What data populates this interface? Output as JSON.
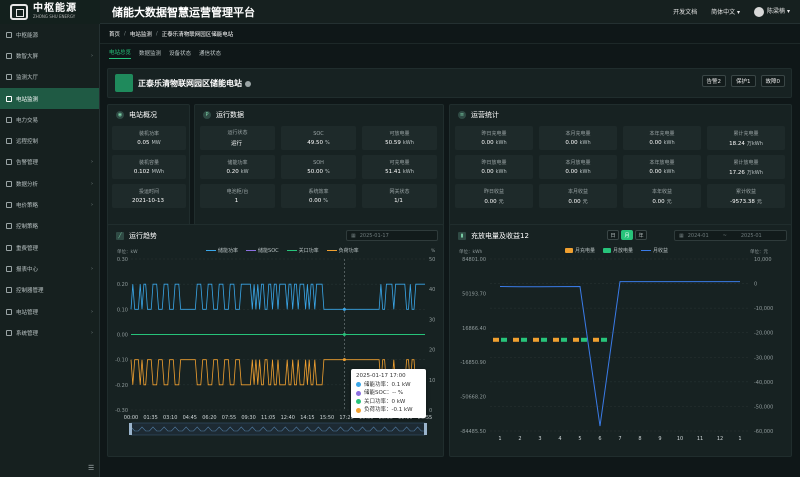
{
  "app": {
    "logo_cn": "中枢能源",
    "logo_en": "ZHONG SHU ENERGY",
    "title": "储能大数据智慧运营管理平台",
    "dev_docs": "开发文档",
    "language": "简体中文",
    "username": "陈梁楠"
  },
  "sidebar": {
    "items": [
      {
        "label": "中枢能源",
        "arrow": false
      },
      {
        "label": "数智大屏",
        "arrow": true
      },
      {
        "label": "监测大厅",
        "arrow": false
      },
      {
        "label": "电站监测",
        "arrow": false,
        "active": true
      },
      {
        "label": "电力交易",
        "arrow": false
      },
      {
        "label": "远程控制",
        "arrow": false
      },
      {
        "label": "告警管理",
        "arrow": true
      },
      {
        "label": "数据分析",
        "arrow": true
      },
      {
        "label": "电价策略",
        "arrow": true
      },
      {
        "label": "控制策略",
        "arrow": false
      },
      {
        "label": "重费管理",
        "arrow": false
      },
      {
        "label": "报表中心",
        "arrow": true
      },
      {
        "label": "控制器管理",
        "arrow": false
      },
      {
        "label": "电站管理",
        "arrow": true
      },
      {
        "label": "系统管理",
        "arrow": true
      }
    ]
  },
  "breadcrumb": [
    "首页",
    "电站监测",
    "正泰乐清物联网园区储能电站"
  ],
  "tabs": [
    "电站总览",
    "数据监测",
    "设备状态",
    "通信状态"
  ],
  "station": {
    "name": "正泰乐清物联网园区储能电站",
    "alarm_buttons": [
      "告警2",
      "保护1",
      "故障0"
    ]
  },
  "overview": {
    "title": "电站概况",
    "cells": [
      {
        "label": "装机功率",
        "value": "0.05",
        "unit": "MW"
      },
      {
        "label": "装机容量",
        "value": "0.102",
        "unit": "MWh"
      },
      {
        "label": "投运时间",
        "value": "2021-10-13",
        "unit": ""
      }
    ]
  },
  "running": {
    "title": "运行数据",
    "cells": [
      {
        "label": "运行状态",
        "value": "运行",
        "unit": ""
      },
      {
        "label": "SOC",
        "value": "49.50",
        "unit": "%"
      },
      {
        "label": "可放电量",
        "value": "50.59",
        "unit": "kWh"
      },
      {
        "label": "储能功率",
        "value": "0.20",
        "unit": "kW"
      },
      {
        "label": "SOH",
        "value": "50.00",
        "unit": "%"
      },
      {
        "label": "可充电量",
        "value": "51.41",
        "unit": "kWh"
      },
      {
        "label": "电池柜/台",
        "value": "1",
        "unit": ""
      },
      {
        "label": "系统效率",
        "value": "0.00",
        "unit": "%"
      },
      {
        "label": "网关状态",
        "value": "1/1",
        "unit": ""
      }
    ]
  },
  "ops": {
    "title": "运营统计",
    "cells": [
      {
        "label": "昨日充电量",
        "value": "0.00",
        "unit": "kWh"
      },
      {
        "label": "本月充电量",
        "value": "0.00",
        "unit": "kWh"
      },
      {
        "label": "本年充电量",
        "value": "0.00",
        "unit": "kWh"
      },
      {
        "label": "累计充电量",
        "value": "18.24",
        "unit": "万kWh"
      },
      {
        "label": "昨日放电量",
        "value": "0.00",
        "unit": "kWh"
      },
      {
        "label": "本月放电量",
        "value": "0.00",
        "unit": "kWh"
      },
      {
        "label": "本年放电量",
        "value": "0.00",
        "unit": "kWh"
      },
      {
        "label": "累计放电量",
        "value": "17.26",
        "unit": "万kWh"
      },
      {
        "label": "昨日收益",
        "value": "0.00",
        "unit": "元"
      },
      {
        "label": "本月收益",
        "value": "0.00",
        "unit": "元"
      },
      {
        "label": "本年收益",
        "value": "0.00",
        "unit": "元"
      },
      {
        "label": "累计收益",
        "value": "-9573.38",
        "unit": "元"
      }
    ]
  },
  "trend": {
    "title": "运行趋势",
    "date": "2025-01-17",
    "unit_left": "单位：kW",
    "unit_right": "%",
    "tooltip": {
      "time": "2025-01-17 17:00",
      "rows": [
        "储能功率：0.1 kW",
        "储能SOC：-- %",
        "关口功率：0 kW",
        "负荷功率：-0.1 kW"
      ]
    },
    "colors": {
      "storage": "#3aa6e8",
      "soc": "#8b6fe0",
      "gate": "#27c37a",
      "load": "#f0a030"
    }
  },
  "revenue": {
    "title": "充放电量及收益12",
    "toggle": [
      "日",
      "月",
      "年"
    ],
    "toggle_active": 1,
    "date_start": "2024-01",
    "date_to": "~",
    "date_end": "2025-01",
    "unit_left": "单位：kWh",
    "unit_right": "单位：元",
    "colors": {
      "charge": "#f0a030",
      "discharge": "#27c37a",
      "income": "#3a7be8"
    }
  },
  "chart_data": [
    {
      "type": "line",
      "title": "运行趋势",
      "series": [
        {
          "name": "储能功率"
        },
        {
          "name": "储能SOC"
        },
        {
          "name": "关口功率"
        },
        {
          "name": "负荷功率"
        }
      ],
      "x_ticks": [
        "00:00",
        "01:35",
        "03:10",
        "04:45",
        "06:20",
        "07:55",
        "09:30",
        "11:05",
        "12:40",
        "14:15",
        "15:50",
        "17:25",
        "19:00",
        "20:35",
        "22:10",
        "23:55"
      ],
      "y_left_ticks": [
        "0.30",
        "0.20",
        "0.10",
        "0.00",
        "-0.10",
        "-0.20",
        "-0.30"
      ],
      "y_right_ticks": [
        "50",
        "40",
        "30",
        "20",
        "10",
        "0"
      ],
      "ylim": [
        -0.3,
        0.3
      ]
    },
    {
      "type": "bar",
      "title": "充放电量及收益12",
      "categories": [
        "1",
        "2",
        "3",
        "4",
        "5",
        "6",
        "7",
        "8",
        "9",
        "10",
        "11",
        "12",
        "1"
      ],
      "series": [
        {
          "name": "月充电量",
          "values": [
            0,
            0,
            0,
            0,
            0,
            0,
            0,
            0,
            0,
            0,
            0,
            0,
            0
          ]
        },
        {
          "name": "月放电量",
          "values": [
            0,
            0,
            0,
            0,
            0,
            0,
            0,
            0,
            0,
            0,
            0,
            0,
            0
          ]
        },
        {
          "name": "月收益",
          "values": [
            -1200,
            -1300,
            -1300,
            -1250,
            -1200,
            -58000,
            800,
            800,
            800,
            800,
            800,
            800,
            800
          ]
        }
      ],
      "y_left_ticks": [
        "84801.00",
        "50193.70",
        "16866.40",
        "-16850.90",
        "-50668.20",
        "-84485.50"
      ],
      "y_right_ticks": [
        "10,000",
        "0",
        "-10,000",
        "-20,000",
        "-30,000",
        "-40,000",
        "-50,000",
        "-60,000"
      ]
    }
  ]
}
